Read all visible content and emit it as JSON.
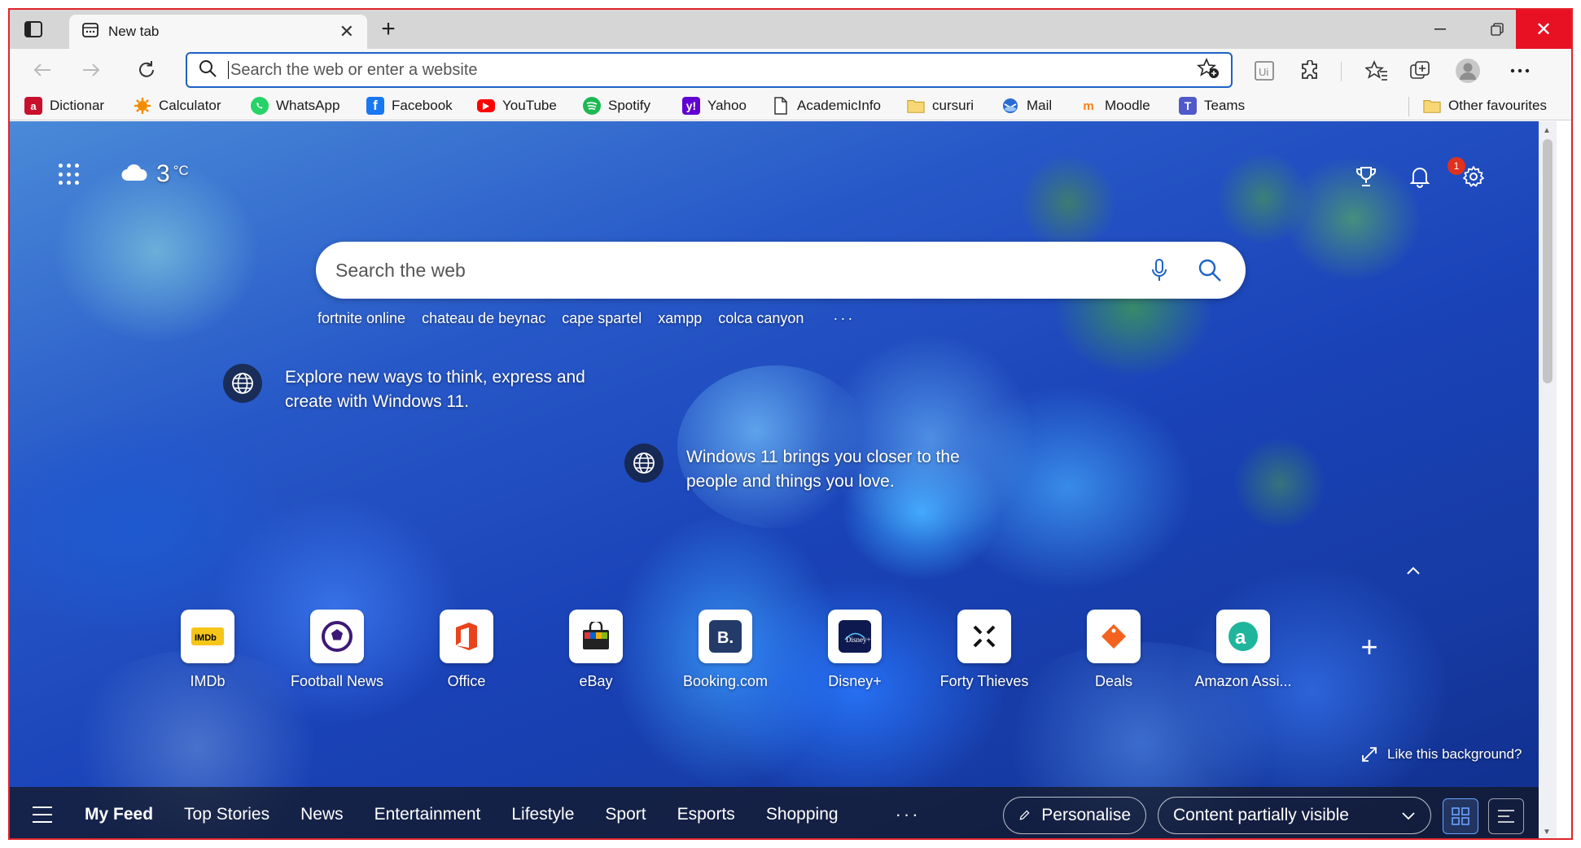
{
  "browser": {
    "tab_title": "New tab",
    "address_placeholder": "Search the web or enter a website"
  },
  "favourites": [
    {
      "label": "Dictionar",
      "icon": "dictionar-icon",
      "color": "#c8102e"
    },
    {
      "label": "Calculator",
      "icon": "calculator-icon",
      "color": "#f28c00"
    },
    {
      "label": "WhatsApp",
      "icon": "whatsapp-icon",
      "color": "#25d366"
    },
    {
      "label": "Facebook",
      "icon": "facebook-icon",
      "color": "#1877f2"
    },
    {
      "label": "YouTube",
      "icon": "youtube-icon",
      "color": "#ff0000"
    },
    {
      "label": "Spotify",
      "icon": "spotify-icon",
      "color": "#1db954"
    },
    {
      "label": "Yahoo",
      "icon": "yahoo-icon",
      "color": "#6001d2"
    },
    {
      "label": "AcademicInfo",
      "icon": "page-icon",
      "color": "#ffffff"
    },
    {
      "label": "cursuri",
      "icon": "folder-icon",
      "color": "#f5c451"
    },
    {
      "label": "Mail",
      "icon": "mail-icon",
      "color": "#2a6bd1"
    },
    {
      "label": "Moodle",
      "icon": "moodle-icon",
      "color": "#f98012"
    },
    {
      "label": "Teams",
      "icon": "teams-icon",
      "color": "#5059c9"
    }
  ],
  "other_favourites": "Other favourites",
  "ntp": {
    "temperature": "3",
    "temp_unit": "°C",
    "notification_count": "1",
    "search_placeholder": "Search the web",
    "trending": [
      "fortnite online",
      "chateau de beynac",
      "cape spartel",
      "xampp",
      "colca canyon"
    ],
    "trending_more": "···",
    "promo1": "Explore new ways to think, express and create with Windows 11.",
    "promo2": "Windows 11 brings you closer to the people and things you love.",
    "quick_links": [
      {
        "label": "IMDb",
        "icon": "imdb-icon"
      },
      {
        "label": "Football News",
        "icon": "football-icon"
      },
      {
        "label": "Office",
        "icon": "office-icon"
      },
      {
        "label": "eBay",
        "icon": "ebay-icon"
      },
      {
        "label": "Booking.com",
        "icon": "booking-icon"
      },
      {
        "label": "Disney+",
        "icon": "disney-icon"
      },
      {
        "label": "Forty Thieves",
        "icon": "forty-thieves-icon"
      },
      {
        "label": "Deals",
        "icon": "deals-icon"
      },
      {
        "label": "Amazon Assi...",
        "icon": "amazon-assistant-icon"
      }
    ],
    "add_tile": "+",
    "like_background": "Like this background?"
  },
  "feed": {
    "tabs": [
      "My Feed",
      "Top Stories",
      "News",
      "Entertainment",
      "Lifestyle",
      "Sport",
      "Esports",
      "Shopping"
    ],
    "more": "···",
    "personalise": "Personalise",
    "content_visibility": "Content partially visible"
  }
}
